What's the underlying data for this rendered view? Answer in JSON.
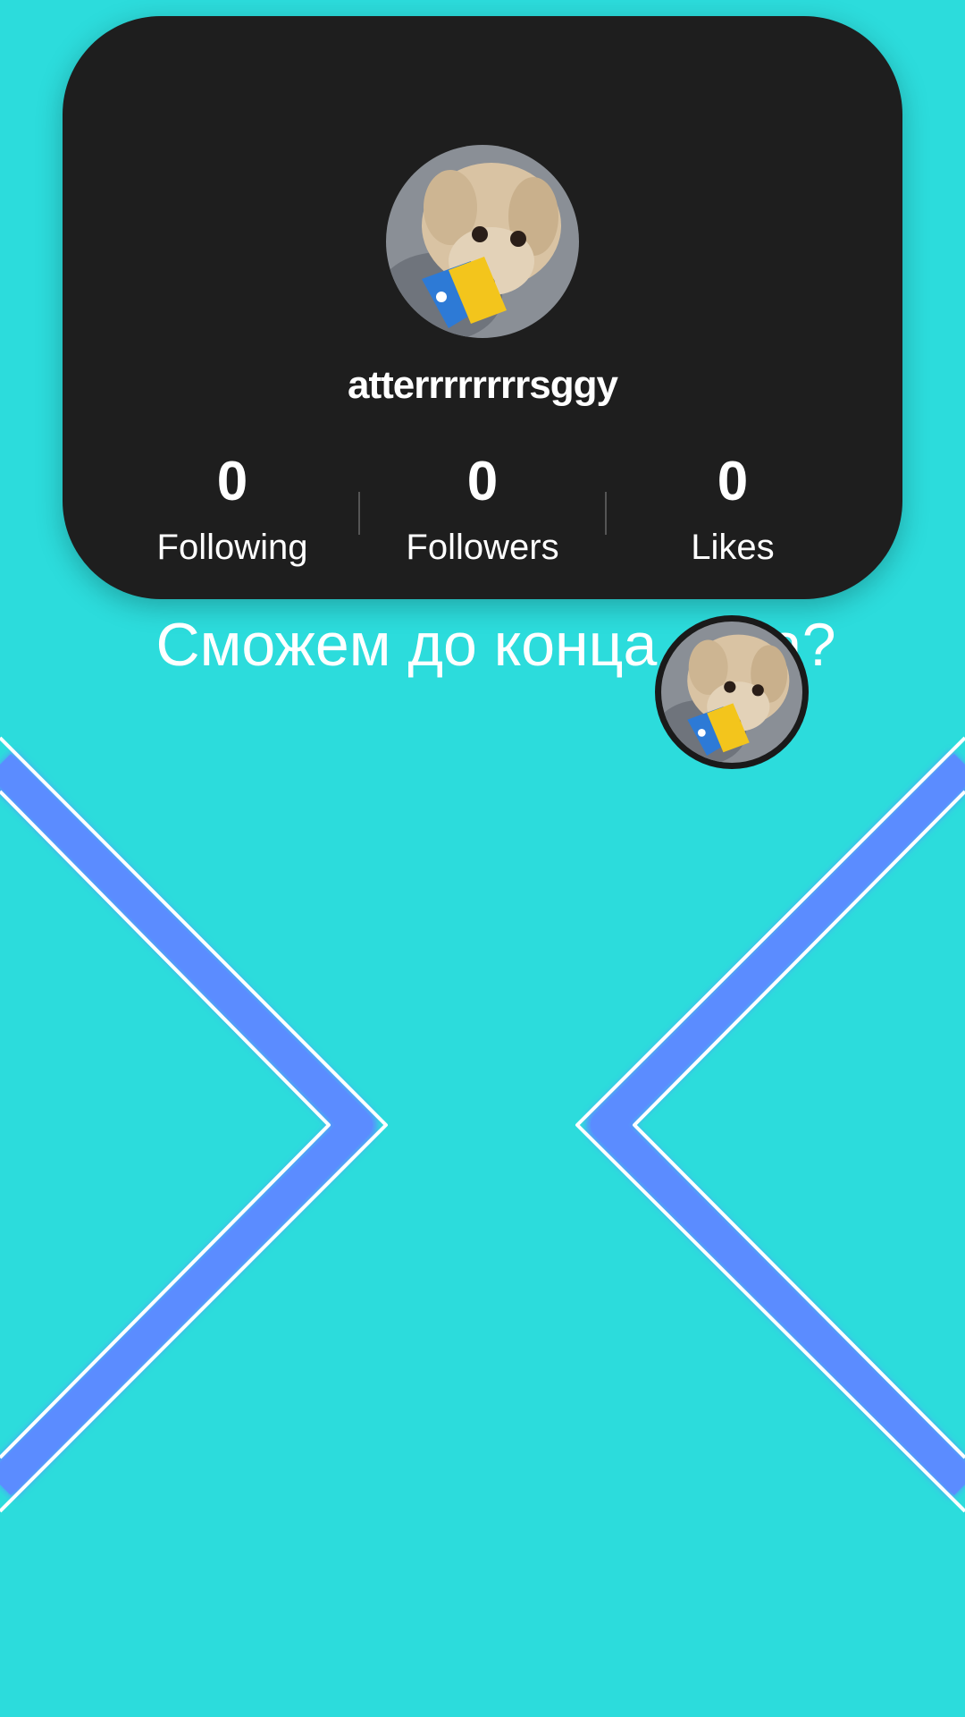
{
  "profile": {
    "username": "atterrrrrrrrsggy",
    "avatar_icon": "dog-avatar-icon",
    "stats": [
      {
        "count": "0",
        "label": "Following"
      },
      {
        "count": "0",
        "label": "Followers"
      },
      {
        "count": "0",
        "label": "Likes"
      }
    ]
  },
  "caption": "Сможем до конца лета?",
  "colors": {
    "background": "#2cdcdc",
    "card": "#1e1e1e",
    "chevron": "#5b8cff",
    "text": "#ffffff"
  }
}
